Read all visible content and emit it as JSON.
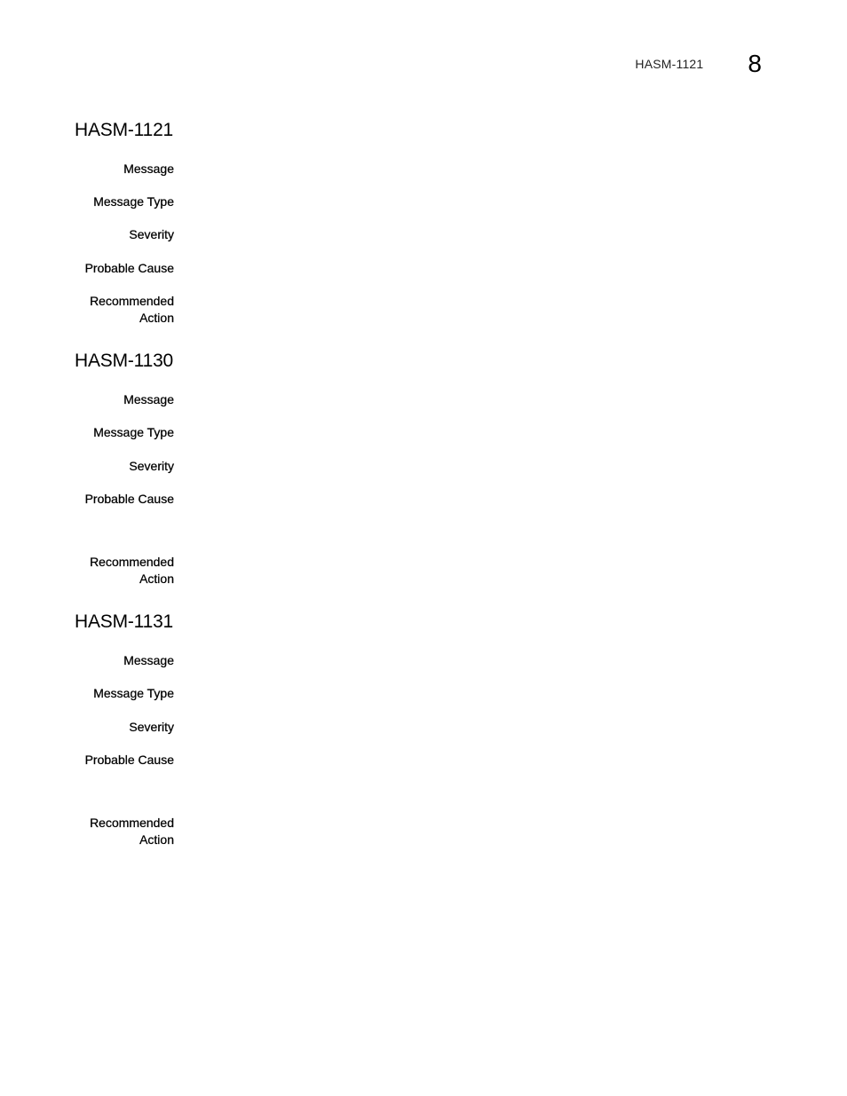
{
  "header": {
    "running_title": "HASM-1121",
    "chapter_number": "8"
  },
  "sections": [
    {
      "title": "HASM-1121",
      "fields": [
        {
          "label": "Message",
          "value": ""
        },
        {
          "label": "Message Type",
          "value": ""
        },
        {
          "label": "Severity",
          "value": ""
        },
        {
          "label": "Probable Cause",
          "value": ""
        },
        {
          "label_line1": "Recommended",
          "label_line2": "Action",
          "value": ""
        }
      ]
    },
    {
      "title": "HASM-1130",
      "fields": [
        {
          "label": "Message",
          "value": ""
        },
        {
          "label": "Message Type",
          "value": ""
        },
        {
          "label": "Severity",
          "value": ""
        },
        {
          "label": "Probable Cause",
          "value": ""
        },
        {
          "label_line1": "Recommended",
          "label_line2": "Action",
          "value": ""
        }
      ]
    },
    {
      "title": "HASM-1131",
      "fields": [
        {
          "label": "Message",
          "value": ""
        },
        {
          "label": "Message Type",
          "value": ""
        },
        {
          "label": "Severity",
          "value": ""
        },
        {
          "label": "Probable Cause",
          "value": ""
        },
        {
          "label_line1": "Recommended",
          "label_line2": "Action",
          "value": ""
        }
      ]
    }
  ]
}
